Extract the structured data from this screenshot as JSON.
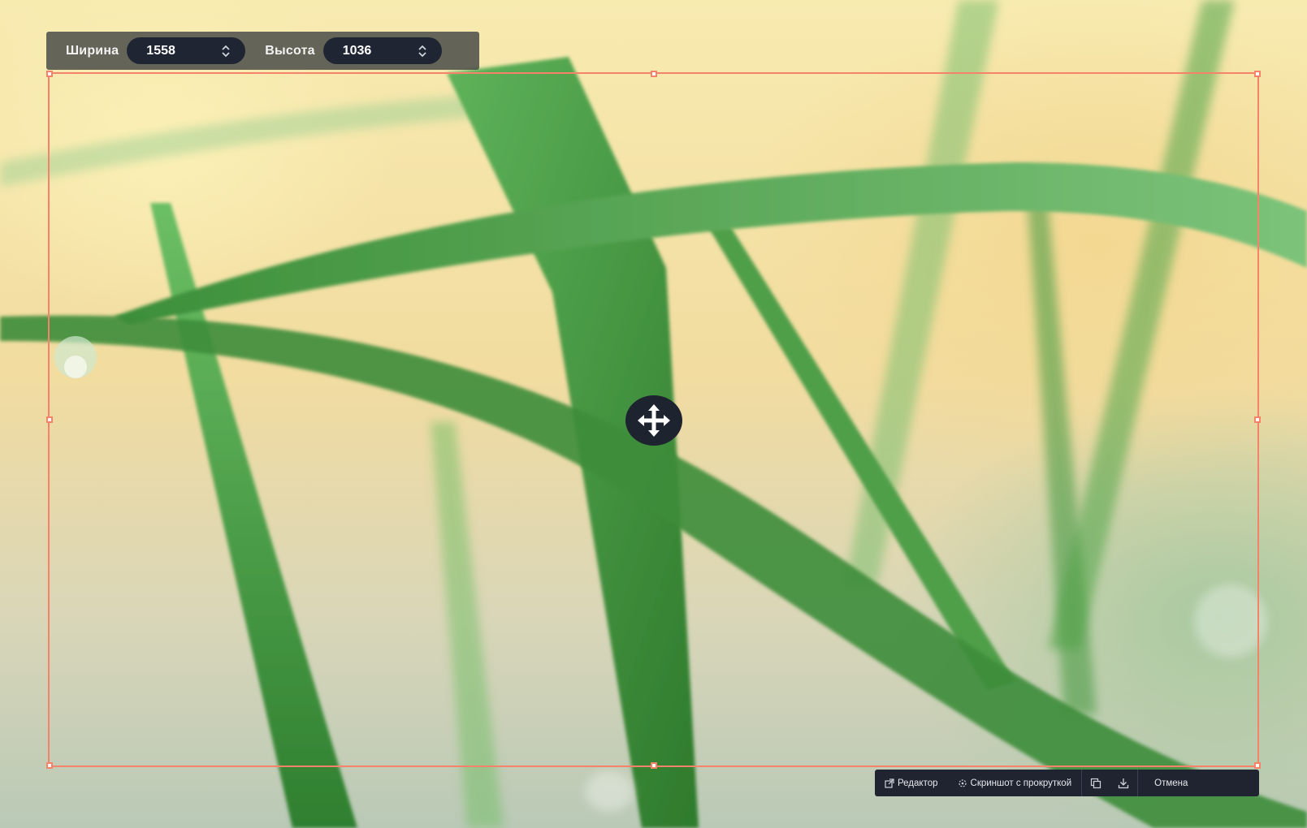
{
  "size_panel": {
    "width_label": "Ширина",
    "width_value": "1558",
    "height_label": "Высота",
    "height_value": "1036"
  },
  "toolbar": {
    "editor_label": "Редактор",
    "scroll_screenshot_label": "Скриншот с прокруткой",
    "copy_icon": "copy-icon",
    "download_icon": "download-icon",
    "cancel_label": "Отмена"
  },
  "colors": {
    "selection_border": "#f4836a",
    "panel_dark": "#1f2430",
    "grass_green": "#3e8f3a"
  },
  "icons": {
    "move": "move-arrows-icon",
    "editor": "external-edit-icon",
    "scroll": "scroll-capture-icon"
  }
}
